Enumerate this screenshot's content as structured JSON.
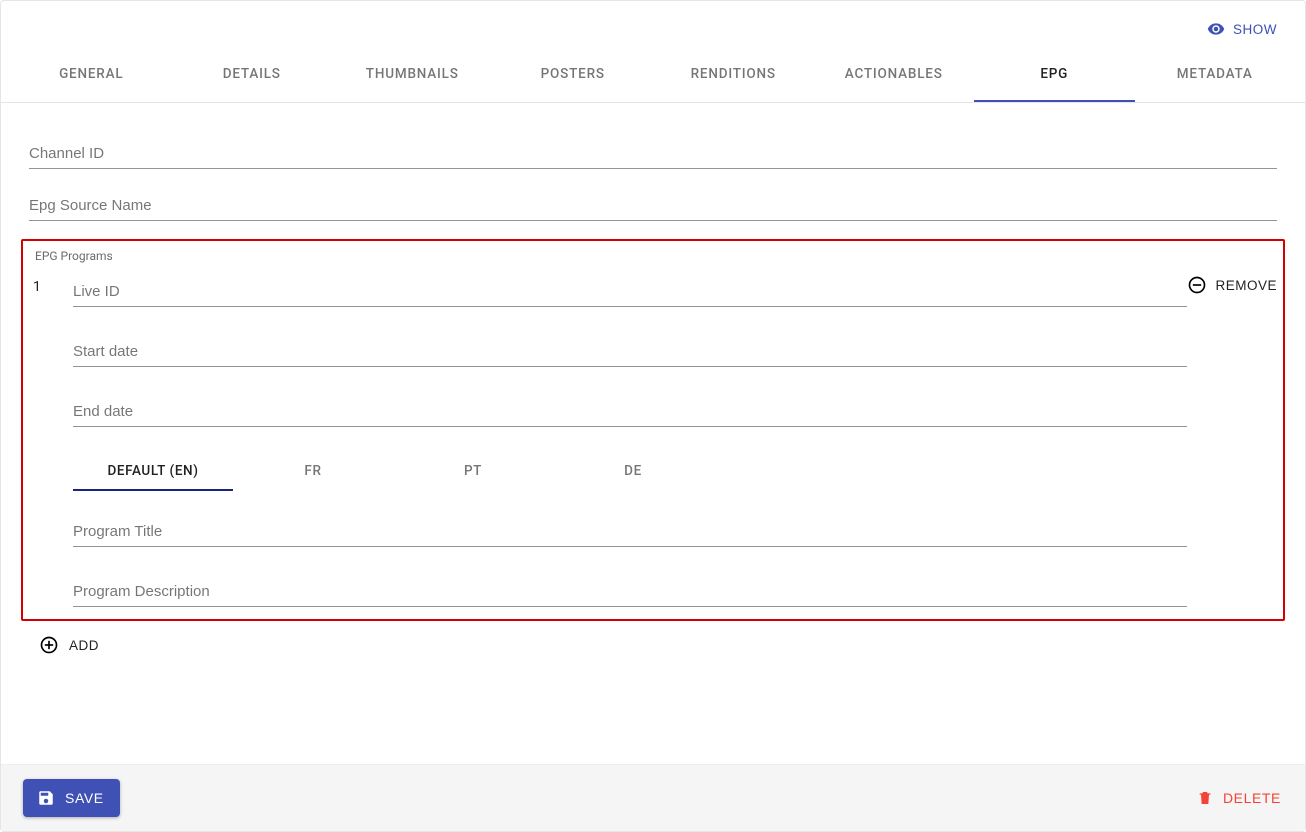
{
  "topbar": {
    "show_label": "SHOW"
  },
  "tabs": [
    {
      "label": "GENERAL",
      "active": false
    },
    {
      "label": "DETAILS",
      "active": false
    },
    {
      "label": "THUMBNAILS",
      "active": false
    },
    {
      "label": "POSTERS",
      "active": false
    },
    {
      "label": "RENDITIONS",
      "active": false
    },
    {
      "label": "ACTIONABLES",
      "active": false
    },
    {
      "label": "EPG",
      "active": true
    },
    {
      "label": "METADATA",
      "active": false
    }
  ],
  "fields": {
    "channel_id": {
      "placeholder": "Channel ID",
      "value": ""
    },
    "epg_source_name": {
      "placeholder": "Epg Source Name",
      "value": ""
    }
  },
  "programs": {
    "section_label": "EPG Programs",
    "remove_label": "REMOVE",
    "add_label": "ADD",
    "items": [
      {
        "index": "1",
        "live_id": {
          "placeholder": "Live ID",
          "value": ""
        },
        "start_date": {
          "placeholder": "Start date",
          "value": ""
        },
        "end_date": {
          "placeholder": "End date",
          "value": ""
        },
        "lang_tabs": [
          {
            "label": "DEFAULT (EN)",
            "active": true
          },
          {
            "label": "FR",
            "active": false
          },
          {
            "label": "PT",
            "active": false
          },
          {
            "label": "DE",
            "active": false
          }
        ],
        "program_title": {
          "placeholder": "Program Title",
          "value": ""
        },
        "program_description": {
          "placeholder": "Program Description",
          "value": ""
        }
      }
    ]
  },
  "footer": {
    "save_label": "SAVE",
    "delete_label": "DELETE"
  }
}
